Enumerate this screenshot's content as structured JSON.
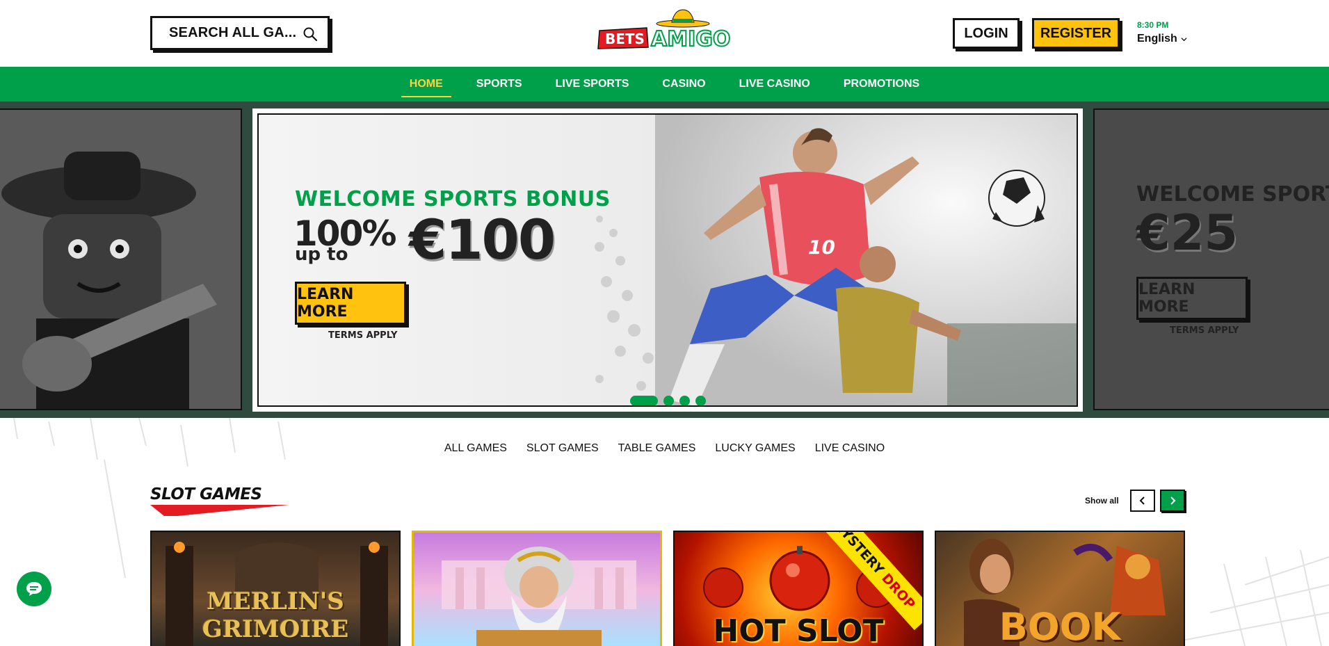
{
  "header": {
    "search_text": "SEARCH ALL GA...",
    "login_label": "LOGIN",
    "register_label": "REGISTER",
    "time": "8:30 PM",
    "language": "English",
    "logo_text_left": "BETS",
    "logo_text_right": "AMIGO"
  },
  "nav": {
    "items": [
      {
        "label": "HOME",
        "active": true
      },
      {
        "label": "SPORTS"
      },
      {
        "label": "LIVE SPORTS"
      },
      {
        "label": "CASINO"
      },
      {
        "label": "LIVE CASINO"
      },
      {
        "label": "PROMOTIONS"
      }
    ]
  },
  "hero": {
    "main": {
      "subtitle": "WELCOME SPORTS BONUS",
      "percent": "100%",
      "up_to": "up to",
      "amount": "€100",
      "button_label": "LEARN MORE",
      "terms": "TERMS APPLY",
      "jersey_number": "10"
    },
    "next": {
      "subtitle": "WELCOME SPORTS",
      "amount": "€25",
      "button_label": "LEARN MORE",
      "terms": "TERMS APPLY"
    },
    "slide_count": 4,
    "active_slide": 1
  },
  "game_tabs": [
    "ALL GAMES",
    "SLOT GAMES",
    "TABLE GAMES",
    "LUCKY GAMES",
    "LIVE CASINO"
  ],
  "section": {
    "title": "SLOT GAMES",
    "show_all": "Show all"
  },
  "games": [
    {
      "title": "MERLIN'S GRIMOIRE"
    },
    {
      "title": ""
    },
    {
      "title": "HOT SLOT",
      "badge_left": "MYSTERY",
      "badge_right": "DROP"
    },
    {
      "title": "BOOK"
    }
  ],
  "colors": {
    "brand_green": "#00a04a",
    "accent_yellow": "#ffc20e",
    "brand_red": "#e31b23"
  }
}
